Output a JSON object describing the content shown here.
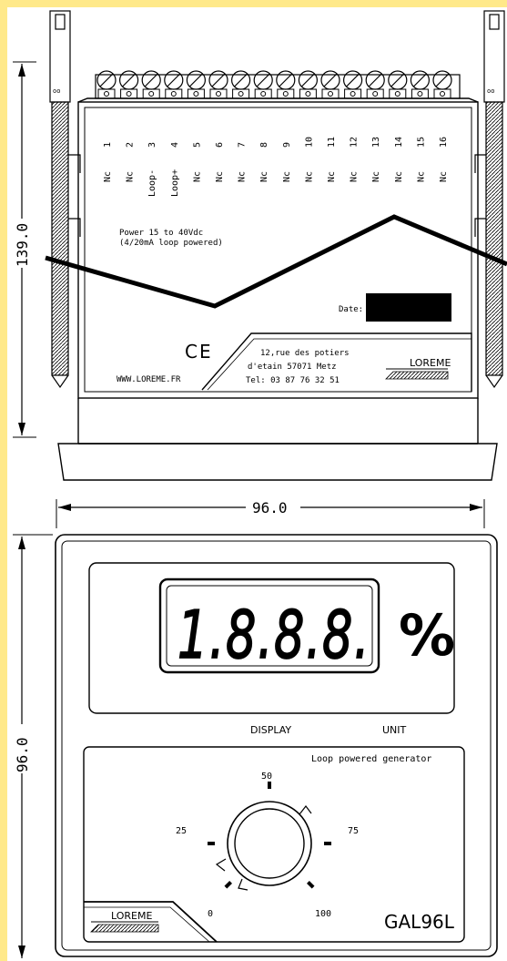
{
  "dimensions": {
    "side_height": "139.0",
    "front_width": "96.0",
    "front_height": "96.0"
  },
  "terminals": [
    {
      "number": "1",
      "label": "Nc"
    },
    {
      "number": "2",
      "label": "Nc"
    },
    {
      "number": "3",
      "label": "Loop-"
    },
    {
      "number": "4",
      "label": "Loop+"
    },
    {
      "number": "5",
      "label": "Nc"
    },
    {
      "number": "6",
      "label": "Nc"
    },
    {
      "number": "7",
      "label": "Nc"
    },
    {
      "number": "8",
      "label": "Nc"
    },
    {
      "number": "9",
      "label": "Nc"
    },
    {
      "number": "10",
      "label": "Nc"
    },
    {
      "number": "11",
      "label": "Nc"
    },
    {
      "number": "12",
      "label": "Nc"
    },
    {
      "number": "13",
      "label": "Nc"
    },
    {
      "number": "14",
      "label": "Nc"
    },
    {
      "number": "15",
      "label": "Nc"
    },
    {
      "number": "16",
      "label": "Nc"
    }
  ],
  "side_label": {
    "power_line1": "Power 15 to 40Vdc",
    "power_line2": "(4/20mA loop powered)",
    "date_label": "Date:",
    "ce_mark": "CE",
    "website": "WWW.LOREME.FR",
    "address_line1": "12,rue des potiers",
    "address_line2": "d'etain 57071 Metz",
    "phone": "Tel: 03 87 76 32 51",
    "brand": "LOREME"
  },
  "front_panel": {
    "display_value": "1.8.8.8.",
    "unit_symbol": "%",
    "display_caption": "DISPLAY",
    "unit_caption": "UNIT",
    "generator_title": "Loop powered generator",
    "dial_marks": [
      "0",
      "25",
      "50",
      "75",
      "100"
    ],
    "brand": "LOREME",
    "model": "GAL96L"
  },
  "colors": {
    "ink": "#000000",
    "page": "#ffffff",
    "margin_highlight": "#ffe98a"
  }
}
